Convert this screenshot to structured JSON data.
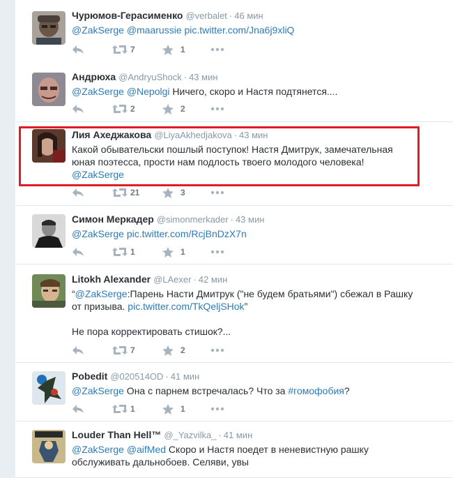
{
  "timeline": {
    "tweets": [
      {
        "fullname": "Чурюмов-Герасименко",
        "username": "@verbalet",
        "time": "46 мин",
        "segments": [
          {
            "text": "@ZakSerge",
            "link": true
          },
          {
            "text": " ",
            "link": false
          },
          {
            "text": "@maarussie",
            "link": true
          },
          {
            "text": " ",
            "link": false
          },
          {
            "text": "pic.twitter.com/Jna6j9xliQ",
            "link": true
          }
        ],
        "retweets": "7",
        "favorites": "1"
      },
      {
        "fullname": "Андрюха",
        "username": "@AndryuShock",
        "time": "43 мин",
        "segments": [
          {
            "text": "@ZakSerge",
            "link": true
          },
          {
            "text": " ",
            "link": false
          },
          {
            "text": "@Nepolgi",
            "link": true
          },
          {
            "text": " Ничего, скоро и Настя подтянется....",
            "link": false
          }
        ],
        "retweets": "2",
        "favorites": "2"
      },
      {
        "fullname": "Лия Ахеджакова",
        "username": "@LiyaAkhedjakova",
        "time": "43 мин",
        "segments": [
          {
            "text": "Какой обывательски пошлый поступок! Настя Дмитрук, замечательная\nюная поэтесса, прости нам подлость твоего молодого человека!\n",
            "link": false
          },
          {
            "text": "@ZakSerge",
            "link": true
          }
        ],
        "retweets": "21",
        "favorites": "3"
      },
      {
        "fullname": "Симон Меркадер",
        "username": "@simonmerkader",
        "time": "43 мин",
        "segments": [
          {
            "text": "@ZakSerge",
            "link": true
          },
          {
            "text": " ",
            "link": false
          },
          {
            "text": "pic.twitter.com/RcjBnDzX7n",
            "link": true
          }
        ],
        "retweets": "1",
        "favorites": "1"
      },
      {
        "fullname": "Litokh Alexander",
        "username": "@LAexer",
        "time": "42 мин",
        "segments": [
          {
            "text": "“",
            "link": false
          },
          {
            "text": "@ZakSerge",
            "link": true
          },
          {
            "text": ":Парень Насти Дмитрук (\"не будем братьями\") сбежал в Рашку\nот призыва. ",
            "link": false
          },
          {
            "text": "pic.twitter.com/TkQeljSHok",
            "link": true
          },
          {
            "text": "”\n\nНе пора корректировать стишок?...",
            "link": false
          }
        ],
        "retweets": "7",
        "favorites": "2"
      },
      {
        "fullname": "Pobedit",
        "username": "@020514OD",
        "time": "41 мин",
        "segments": [
          {
            "text": "@ZakSerge",
            "link": true
          },
          {
            "text": " Она с парнем встречалась? Что за ",
            "link": false
          },
          {
            "text": "#гомофобия",
            "link": true
          },
          {
            "text": "?",
            "link": false
          }
        ],
        "retweets": "1",
        "favorites": "1"
      },
      {
        "fullname": "Louder Than Hell™",
        "username": "@_Yazvilka_",
        "time": "41 мин",
        "segments": [
          {
            "text": "@ZakSerge",
            "link": true
          },
          {
            "text": " ",
            "link": false
          },
          {
            "text": "@aifMed",
            "link": true
          },
          {
            "text": " Скоро и Настя поедет в неневистную рашку\nобслуживать дальнобоев. Селяви, увы",
            "link": false
          }
        ],
        "retweets": "",
        "favorites": ""
      }
    ]
  },
  "colors": {
    "link": "#2b7bb9",
    "highlight": "#e01b24",
    "text": "#292f33",
    "muted": "#8899a6"
  }
}
